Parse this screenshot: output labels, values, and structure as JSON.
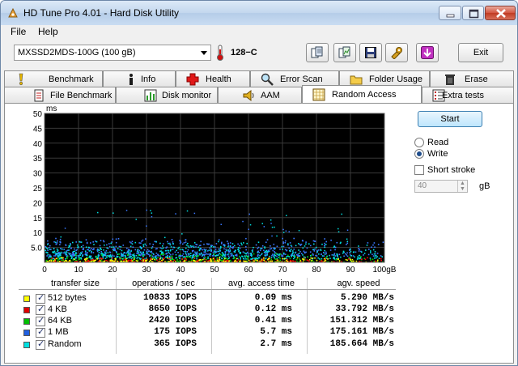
{
  "window": {
    "title": "HD Tune Pro 4.01 - Hard Disk Utility"
  },
  "menu": {
    "file": "File",
    "help": "Help"
  },
  "toolbar": {
    "drive": "MXSSD2MDS-100G (100 gB)",
    "temperature": "128−C",
    "exit_label": "Exit"
  },
  "tabs_row1": [
    {
      "label": "Benchmark",
      "icon": "exclamation-icon"
    },
    {
      "label": "Info",
      "icon": "info-icon"
    },
    {
      "label": "Health",
      "icon": "cross-icon"
    },
    {
      "label": "Error Scan",
      "icon": "magnifier-icon"
    },
    {
      "label": "Folder Usage",
      "icon": "folder-icon"
    },
    {
      "label": "Erase",
      "icon": "trash-icon"
    }
  ],
  "tabs_row2": [
    {
      "label": "File Benchmark",
      "icon": "document-icon"
    },
    {
      "label": "Disk monitor",
      "icon": "chart-icon"
    },
    {
      "label": "AAM",
      "icon": "speaker-icon"
    },
    {
      "label": "Random Access",
      "icon": "grid-icon",
      "active": true
    },
    {
      "label": "Extra tests",
      "icon": "list-icon"
    }
  ],
  "controls": {
    "start_label": "Start",
    "read_label": "Read",
    "write_label": "Write",
    "mode": "Write",
    "short_stroke_label": "Short stroke",
    "short_stroke_value": "40",
    "unit_label": "gB"
  },
  "chart_data": {
    "type": "scatter",
    "ylabel": "ms",
    "xlabel": "gB",
    "ylim": [
      0,
      50
    ],
    "xlim": [
      0,
      100
    ],
    "y_ticks": [
      "50",
      "45",
      "40",
      "35",
      "30",
      "25",
      "20",
      "15",
      "10",
      "5.0"
    ],
    "x_ticks": [
      "0",
      "10",
      "20",
      "30",
      "40",
      "50",
      "60",
      "70",
      "80",
      "90",
      "100gB"
    ],
    "grid": true,
    "series": [
      {
        "name": "512 bytes",
        "color": "#ffff00",
        "y_range": [
          0,
          1.5
        ]
      },
      {
        "name": "4 KB",
        "color": "#ff0000",
        "y_range": [
          0,
          1.5
        ]
      },
      {
        "name": "64 KB",
        "color": "#00cc00",
        "y_range": [
          0,
          3
        ]
      },
      {
        "name": "1 MB",
        "color": "#3a78ff",
        "y_range": [
          2,
          8
        ]
      },
      {
        "name": "Random",
        "color": "#00e0e0",
        "y_range": [
          1,
          7
        ]
      }
    ]
  },
  "table": {
    "headers": [
      "transfer size",
      "operations / sec",
      "avg. access time",
      "agv. speed"
    ],
    "rows": [
      {
        "name": "512 bytes",
        "color": "#ffff00",
        "ops": "10833 IOPS",
        "access": "0.09 ms",
        "speed": "5.290 MB/s"
      },
      {
        "name": "4 KB",
        "color": "#e00000",
        "ops": "8650 IOPS",
        "access": "0.12 ms",
        "speed": "33.792 MB/s"
      },
      {
        "name": "64 KB",
        "color": "#00c000",
        "ops": "2420 IOPS",
        "access": "0.41 ms",
        "speed": "151.312 MB/s"
      },
      {
        "name": "1 MB",
        "color": "#2060e0",
        "ops": "175 IOPS",
        "access": "5.7 ms",
        "speed": "175.161 MB/s"
      },
      {
        "name": "Random",
        "color": "#00e0e0",
        "ops": "365 IOPS",
        "access": "2.7 ms",
        "speed": "185.664 MB/s"
      }
    ]
  }
}
